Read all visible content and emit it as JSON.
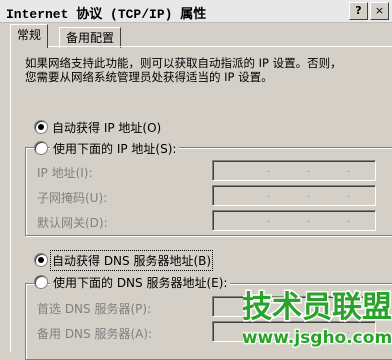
{
  "window": {
    "title": "Internet 协议 (TCP/IP) 属性",
    "help_label": "?",
    "close_label": "×"
  },
  "tabs": [
    {
      "label": "常规"
    },
    {
      "label": "备用配置"
    }
  ],
  "description": {
    "line1": "如果网络支持此功能，则可以获取自动指派的 IP 设置。否则，",
    "line2": "您需要从网络系统管理员处获得适当的 IP 设置。"
  },
  "ip_section": {
    "auto_label": "自动获得 IP 地址(O)",
    "manual_label": "使用下面的 IP 地址(S):",
    "fields": [
      {
        "label": "IP 地址(I):"
      },
      {
        "label": "子网掩码(U):"
      },
      {
        "label": "默认网关(D):"
      }
    ]
  },
  "dns_section": {
    "auto_label": "自动获得 DNS 服务器地址(B)",
    "manual_label": "使用下面的 DNS 服务器地址(E):",
    "fields": [
      {
        "label": "首选 DNS 服务器(P):"
      },
      {
        "label": "备用 DNS 服务器(A):"
      }
    ]
  },
  "watermark": {
    "title": "技术员联盟",
    "url": "www.jsgho.com"
  },
  "colors": {
    "face": "#d4d0c8",
    "watermark_green": "#2aa32a",
    "disabled_text": "#808080"
  }
}
